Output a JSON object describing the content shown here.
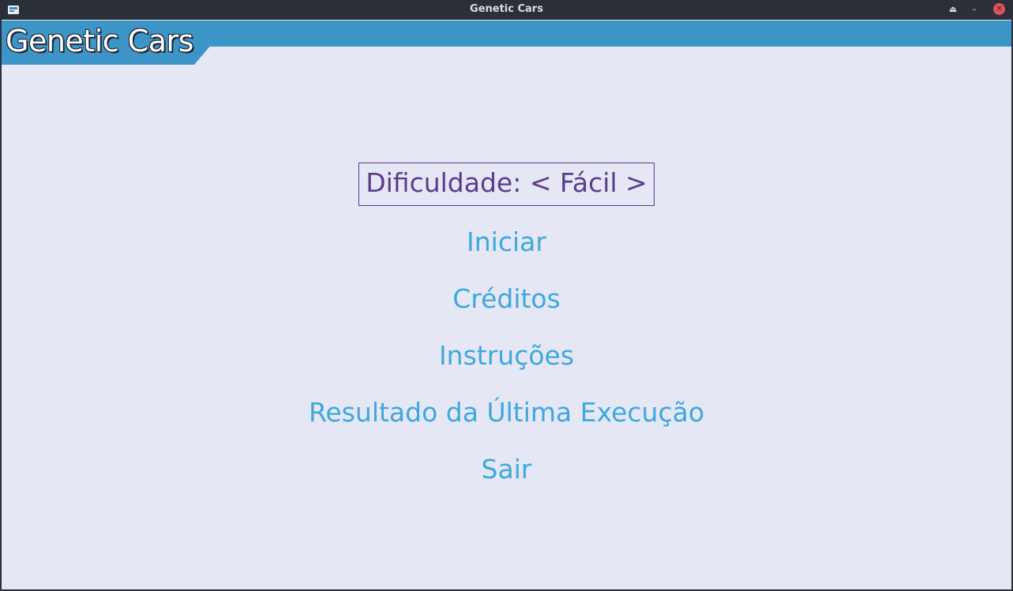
{
  "window": {
    "title": "Genetic Cars",
    "icons": {
      "app": "app-window-icon",
      "keep_above": "eject-icon",
      "minimize": "minimize-icon",
      "close": "close-icon"
    },
    "keep_above_glyph": "⏏",
    "minimize_glyph": "–",
    "close_glyph": "✕"
  },
  "app": {
    "title": "Genetic Cars",
    "header_color": "#3d94c6",
    "background_color": "#e5e7f5"
  },
  "menu": {
    "selected_color": "#5b3c8c",
    "item_color": "#3ea8dc",
    "items": [
      {
        "label": "Dificuldade: < Fácil >",
        "selected": true
      },
      {
        "label": "Iniciar",
        "selected": false
      },
      {
        "label": "Créditos",
        "selected": false
      },
      {
        "label": "Instruções",
        "selected": false
      },
      {
        "label": "Resultado da Última Execução",
        "selected": false
      },
      {
        "label": "Sair",
        "selected": false
      }
    ]
  }
}
